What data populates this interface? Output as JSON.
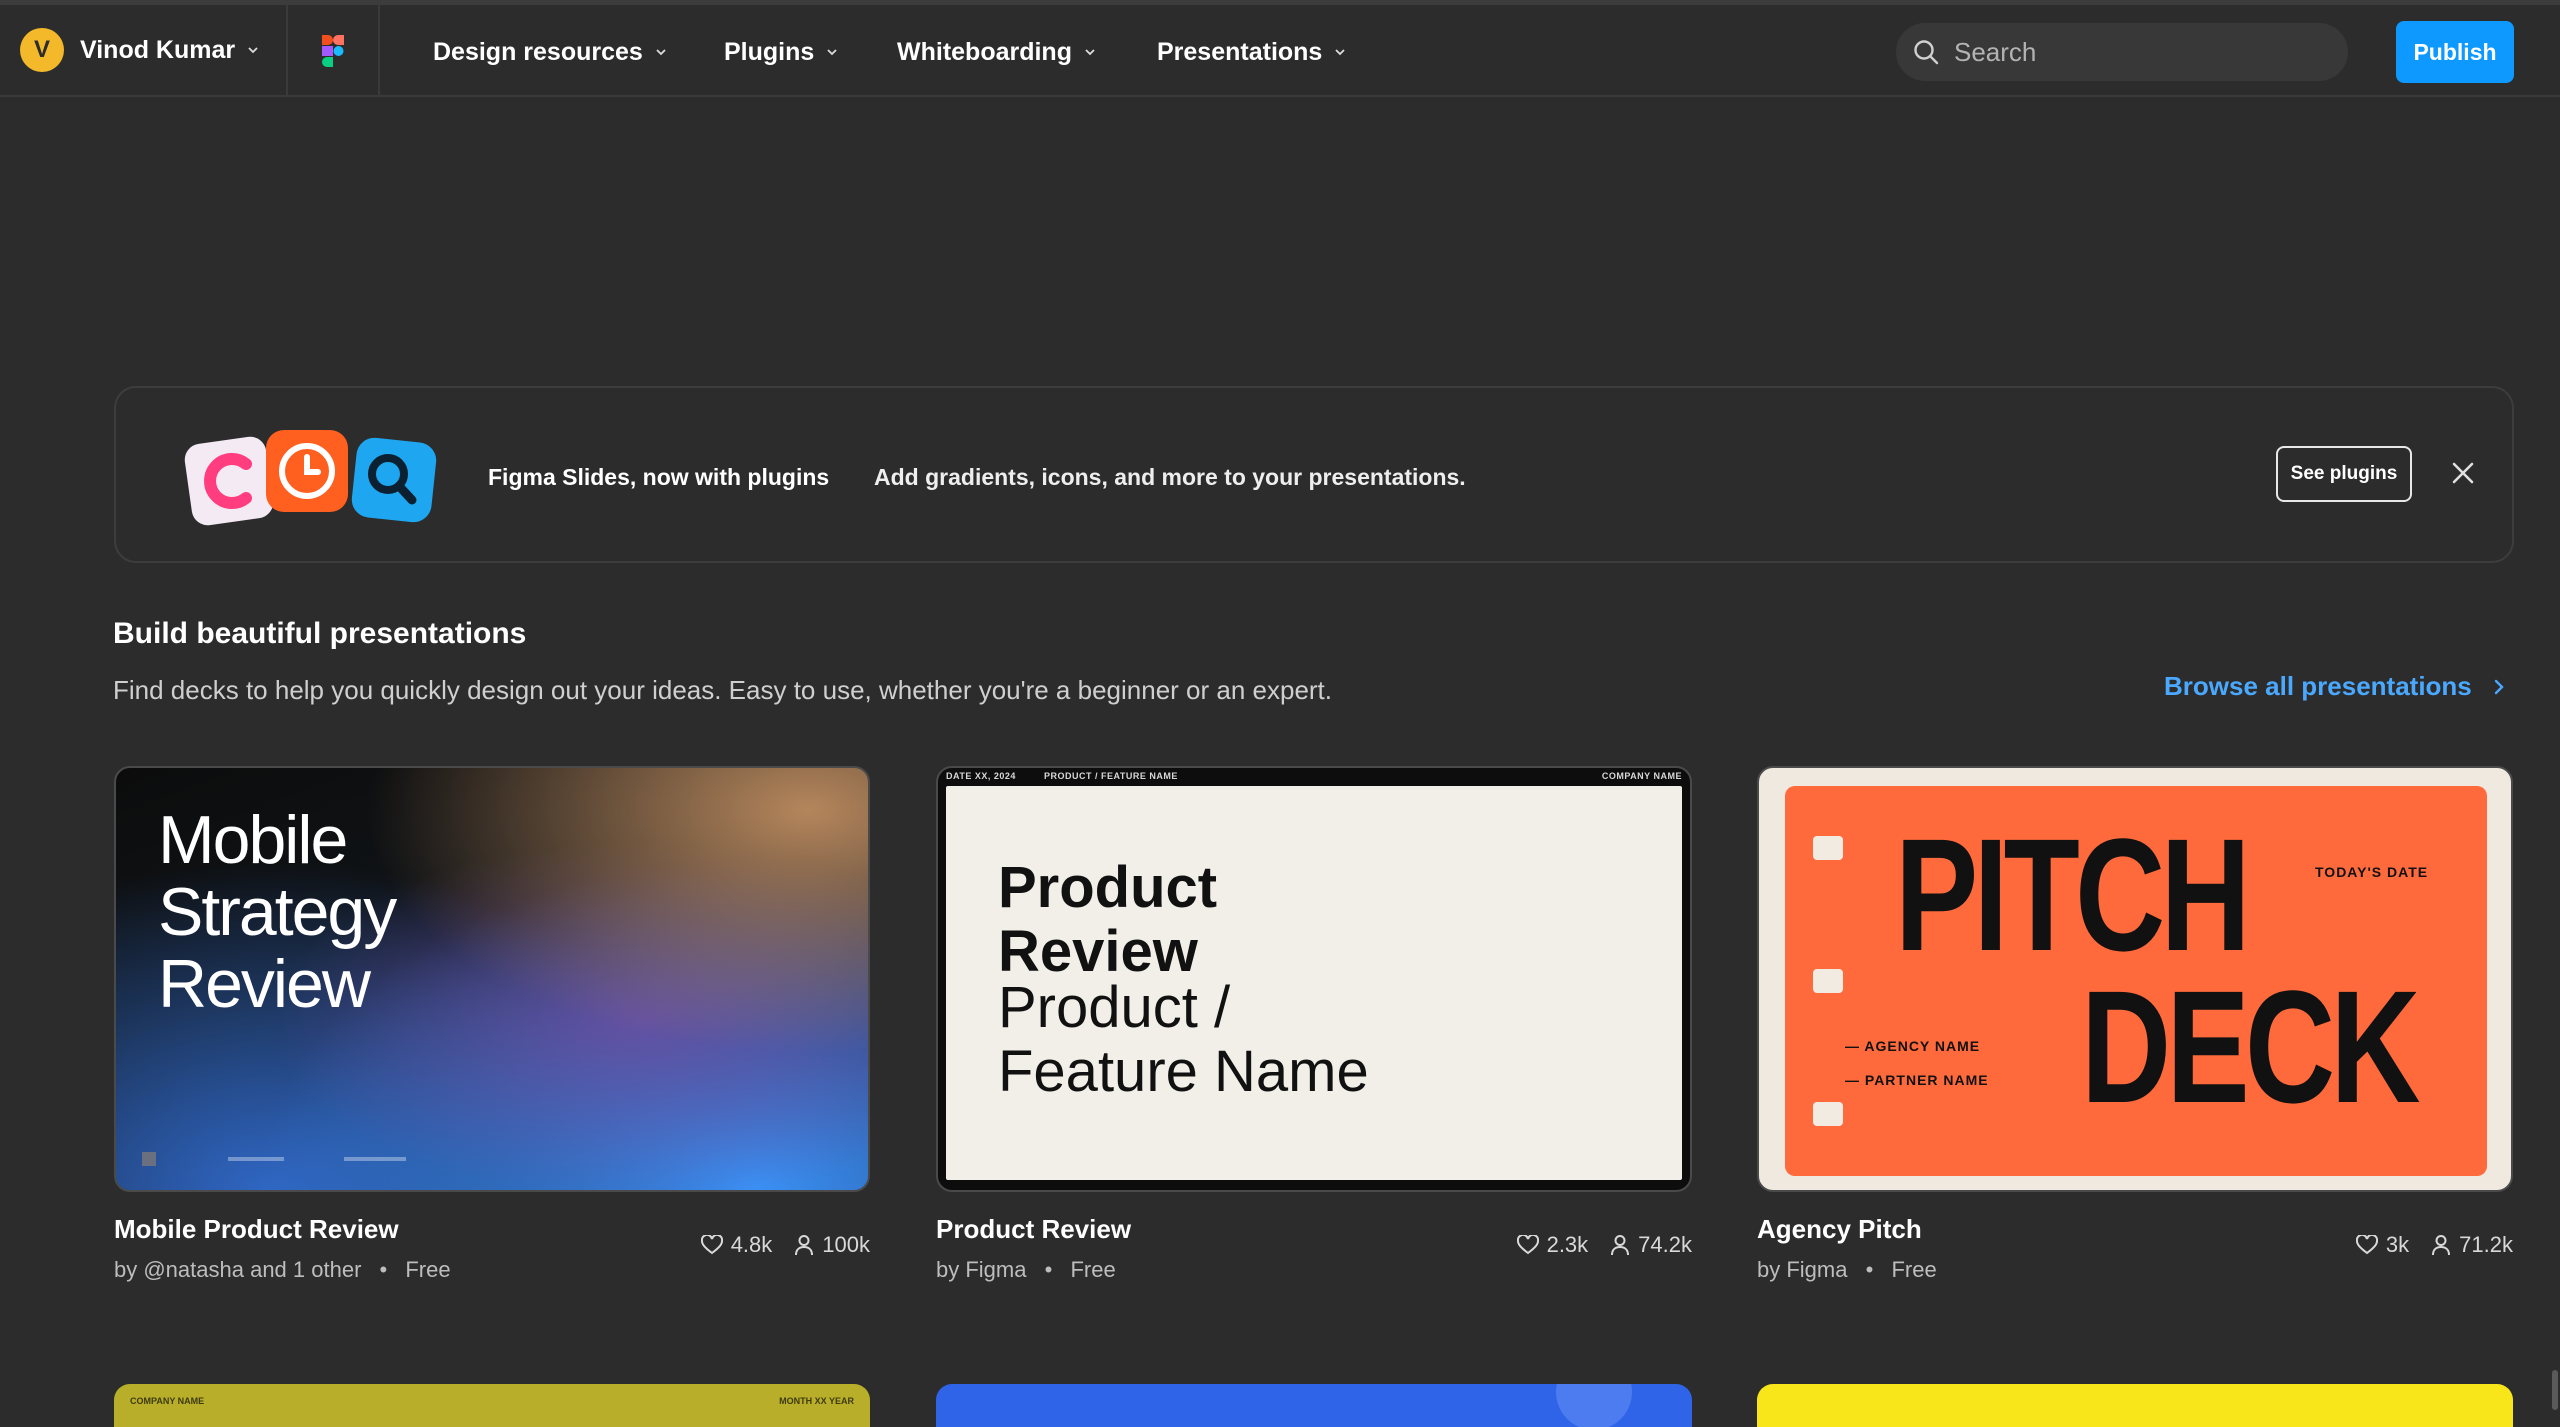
{
  "header": {
    "user": {
      "initial": "V",
      "name": "Vinod Kumar",
      "avatar_color": "#f4b92a"
    },
    "nav": [
      {
        "label": "Design resources"
      },
      {
        "label": "Plugins"
      },
      {
        "label": "Whiteboarding"
      },
      {
        "label": "Presentations"
      }
    ],
    "search": {
      "placeholder": "Search",
      "value": ""
    },
    "publish_label": "Publish",
    "accent_color": "#0d99ff"
  },
  "banner": {
    "title": "Figma Slides, now with plugins",
    "description": "Add gradients, icons, and more to your presentations.",
    "cta_label": "See plugins",
    "icons": [
      "c-plugin-icon",
      "clock-plugin-icon",
      "search-plugin-icon"
    ]
  },
  "section": {
    "title": "Build beautiful presentations",
    "subtitle": "Find decks to help you quickly design out your ideas. Easy to use, whether you're a beginner or an expert.",
    "browse_label": "Browse all presentations"
  },
  "cards": [
    {
      "title": "Mobile Product Review",
      "author": "by @natasha and 1 other",
      "price": "Free",
      "likes": "4.8k",
      "users": "100k",
      "thumb_title": "Mobile Strategy Review"
    },
    {
      "title": "Product Review",
      "author": "by Figma",
      "price": "Free",
      "likes": "2.3k",
      "users": "74.2k",
      "thumb_header_left": "DATE XX, 2024",
      "thumb_header_mid": "PRODUCT / FEATURE NAME",
      "thumb_header_right": "COMPANY NAME",
      "thumb_title": "Product Review",
      "thumb_subtitle": "Product / Feature Name"
    },
    {
      "title": "Agency Pitch",
      "author": "by Figma",
      "price": "Free",
      "likes": "3k",
      "users": "71.2k",
      "thumb_word1": "PITCH",
      "thumb_word2": "DECK",
      "thumb_date": "TODAY'S DATE",
      "thumb_agency": "— AGENCY NAME",
      "thumb_partner": "— PARTNER NAME"
    }
  ],
  "next_row": {
    "left_label_a": "COMPANY NAME",
    "left_label_b": "MONTH XX YEAR",
    "colors": [
      "#b8ae2a",
      "#2f63e8",
      "#f8e51a"
    ]
  },
  "separator_dot": "•"
}
